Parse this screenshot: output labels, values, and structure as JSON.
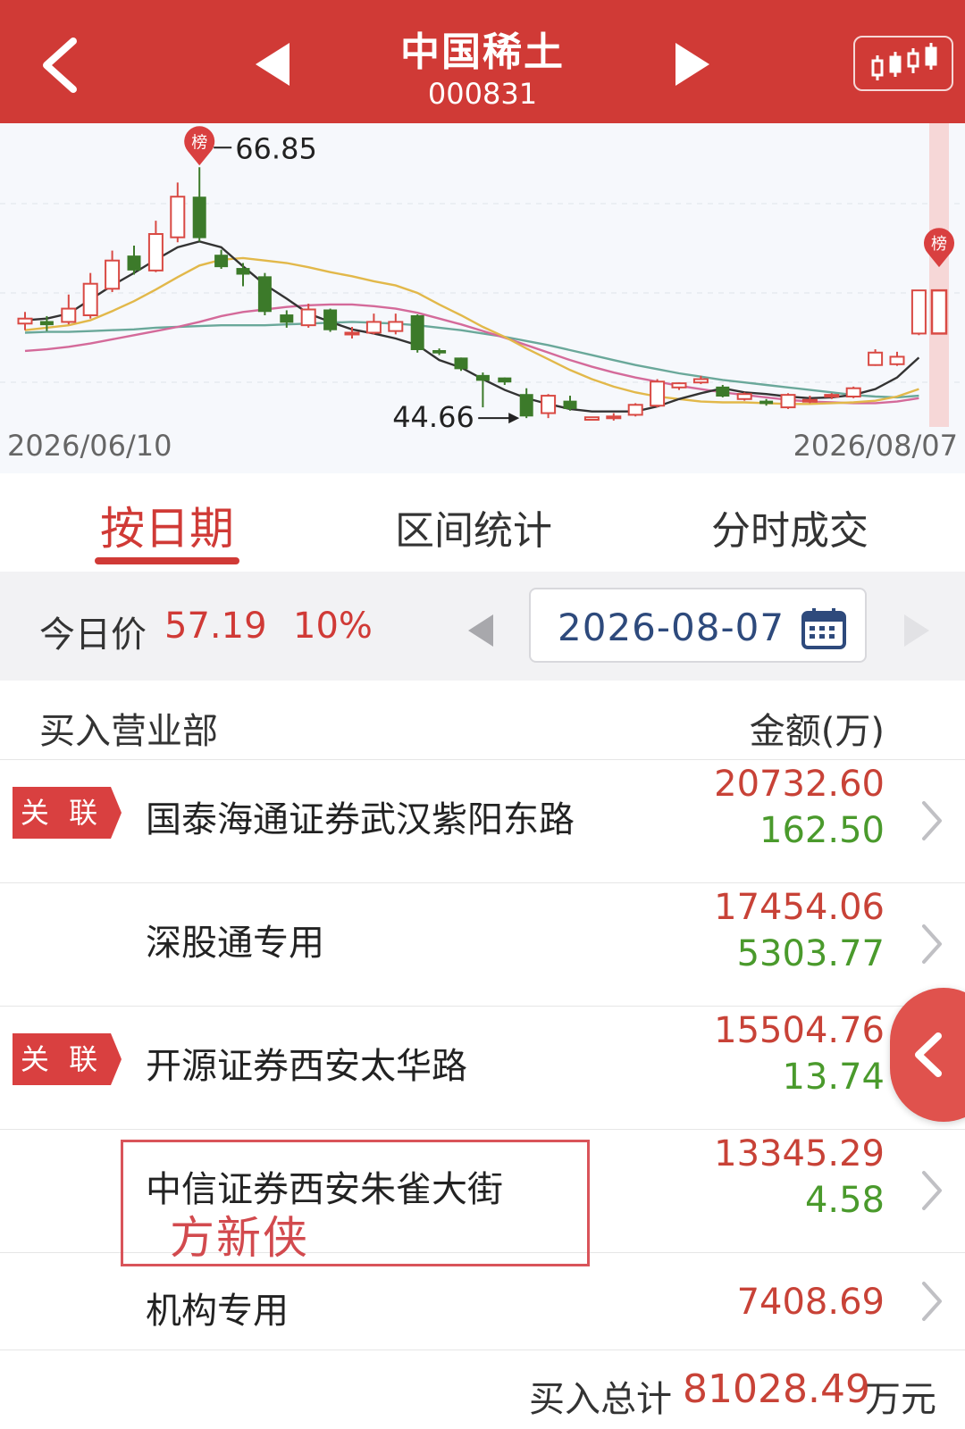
{
  "header": {
    "title": "中国稀土",
    "code": "000831"
  },
  "chart": {
    "high_label": "66.85",
    "low_label": "44.66",
    "start_date": "2026/06/10",
    "end_date": "2026/08/07",
    "badge_text": "榜",
    "colors": {
      "up": "#d94a44",
      "down": "#3c7a2a",
      "ma5": "#333333",
      "ma10": "#e2b84a",
      "ma20": "#d46a9a",
      "ma30": "#6aa89a"
    }
  },
  "tabs": [
    "按日期",
    "区间统计",
    "分时成交"
  ],
  "pricebar": {
    "label": "今日价",
    "price": "57.19",
    "pct": "10%",
    "date": "2026-08-07"
  },
  "table": {
    "col_left": "买入营业部",
    "col_right": "金额(万)",
    "tag_label": "关 联",
    "rows": [
      {
        "name": "国泰海通证券武汉紫阳东路",
        "buy": "20732.60",
        "sell": "162.50",
        "tag": true
      },
      {
        "name": "深股通专用",
        "buy": "17454.06",
        "sell": "5303.77",
        "tag": false
      },
      {
        "name": "开源证券西安太华路",
        "buy": "15504.76",
        "sell": "13.74",
        "tag": true
      },
      {
        "name": "中信证券西安朱雀大街",
        "buy": "13345.29",
        "sell": "4.58",
        "tag": false
      },
      {
        "name": "机构专用",
        "buy": "7408.69",
        "sell": "",
        "tag": false
      }
    ]
  },
  "annotation": "方新侠",
  "footer": {
    "label": "买入总计",
    "value": "81028.49",
    "unit": "万元"
  },
  "chart_data": {
    "type": "candlestick",
    "dates": [
      "2026/06/10",
      "2026/08/07"
    ],
    "candles": [
      [
        48.0,
        48.6,
        47.2,
        49.4
      ],
      [
        48.3,
        47.8,
        47.1,
        48.9
      ],
      [
        48.2,
        49.8,
        47.9,
        51.5
      ],
      [
        49.0,
        52.8,
        48.6,
        54.1
      ],
      [
        52.2,
        55.6,
        51.8,
        56.8
      ],
      [
        56.2,
        54.4,
        53.9,
        57.4
      ],
      [
        54.4,
        58.8,
        54.2,
        60.4
      ],
      [
        58.4,
        63.3,
        57.8,
        65.0
      ],
      [
        63.3,
        58.3,
        57.9,
        66.85
      ],
      [
        56.3,
        54.8,
        54.6,
        56.9
      ],
      [
        54.7,
        53.9,
        52.5,
        55.3
      ],
      [
        53.7,
        49.4,
        49.0,
        54.1
      ],
      [
        49.1,
        48.1,
        47.5,
        49.6
      ],
      [
        47.8,
        49.7,
        47.5,
        50.4
      ],
      [
        49.7,
        47.2,
        47.0,
        49.8
      ],
      [
        46.7,
        46.9,
        46.2,
        47.6
      ],
      [
        46.9,
        48.2,
        46.7,
        49.2
      ],
      [
        47.1,
        48.2,
        46.7,
        49.2
      ],
      [
        49.0,
        44.8,
        44.5,
        49.1
      ],
      [
        44.8,
        44.4,
        44.2,
        45.0
      ],
      [
        43.9,
        42.5,
        42.3,
        43.9
      ],
      [
        41.8,
        41.1,
        37.9,
        42.1
      ],
      [
        41.5,
        40.9,
        40.6,
        41.5
      ],
      [
        39.5,
        36.8,
        36.6,
        40.2
      ],
      [
        37.2,
        39.3,
        36.6,
        39.5
      ],
      [
        38.7,
        37.7,
        37.5,
        39.3
      ],
      [
        36.4,
        36.7,
        36.3,
        36.7
      ],
      [
        36.6,
        36.8,
        36.3,
        37.2
      ],
      [
        37.0,
        38.2,
        36.8,
        38.4
      ],
      [
        38.1,
        41.0,
        37.9,
        41.3
      ],
      [
        40.3,
        40.8,
        40.0,
        40.9
      ],
      [
        40.9,
        41.3,
        40.7,
        41.7
      ],
      [
        40.4,
        39.2,
        39.1,
        40.6
      ],
      [
        38.9,
        39.5,
        38.7,
        39.7
      ],
      [
        38.7,
        38.3,
        38.1,
        38.9
      ],
      [
        37.9,
        39.4,
        37.7,
        39.6
      ],
      [
        38.8,
        38.8,
        38.4,
        39.3
      ],
      [
        39.2,
        39.4,
        38.9,
        39.6
      ],
      [
        39.2,
        40.2,
        39.0,
        40.4
      ],
      [
        43.0,
        44.5,
        42.9,
        44.9
      ],
      [
        43.1,
        44.0,
        42.9,
        44.6
      ],
      [
        46.8,
        52.0,
        46.6,
        52.0
      ]
    ],
    "series": [
      {
        "name": "MA5",
        "values": [
          48.4,
          48.6,
          49.2,
          50.9,
          52.6,
          54.1,
          55.7,
          57.2,
          57.9,
          57.2,
          54.9,
          52.7,
          51.0,
          49.2,
          48.2,
          47.3,
          46.8,
          46.2,
          45.4,
          43.6,
          42.7,
          41.3,
          40.0,
          39.0,
          38.3,
          37.7,
          37.4,
          37.4,
          37.4,
          38.0,
          38.9,
          39.6,
          40.2,
          39.7,
          39.5,
          39.2,
          39.0,
          39.1,
          39.4,
          40.1,
          41.5,
          43.9
        ]
      },
      {
        "name": "MA10",
        "values": [
          47.2,
          47.5,
          47.8,
          48.4,
          49.5,
          50.7,
          52.1,
          53.6,
          55.0,
          55.7,
          55.9,
          55.6,
          55.3,
          54.8,
          54.2,
          53.7,
          53.1,
          52.6,
          51.7,
          50.3,
          49.0,
          47.6,
          46.4,
          45.0,
          43.7,
          42.4,
          41.3,
          40.4,
          39.7,
          39.2,
          38.9,
          38.6,
          38.5,
          38.5,
          38.4,
          38.3,
          38.3,
          38.4,
          38.5,
          38.7,
          39.2,
          40.1
        ]
      },
      {
        "name": "MA20",
        "values": [
          44.7,
          44.9,
          45.2,
          45.6,
          46.1,
          46.6,
          47.1,
          47.6,
          48.2,
          48.9,
          49.4,
          49.7,
          50.0,
          50.2,
          50.3,
          50.3,
          50.1,
          49.8,
          49.3,
          48.6,
          47.9,
          47.1,
          46.3,
          45.4,
          44.5,
          43.6,
          42.8,
          42.1,
          41.5,
          41.0,
          40.5,
          40.1,
          39.7,
          39.4,
          39.1,
          38.8,
          38.6,
          38.5,
          38.4,
          38.4,
          38.6,
          39.0
        ]
      },
      {
        "name": "MA30",
        "values": [
          46.9,
          47.0,
          47.0,
          47.1,
          47.2,
          47.3,
          47.5,
          47.6,
          47.7,
          47.8,
          47.8,
          47.8,
          47.9,
          48.0,
          48.1,
          48.2,
          48.1,
          48.0,
          47.8,
          47.5,
          47.2,
          46.8,
          46.4,
          45.9,
          45.4,
          44.8,
          44.2,
          43.6,
          43.0,
          42.5,
          42.0,
          41.6,
          41.2,
          40.9,
          40.6,
          40.3,
          40.0,
          39.7,
          39.4,
          39.2,
          39.1,
          39.3
        ]
      }
    ]
  }
}
